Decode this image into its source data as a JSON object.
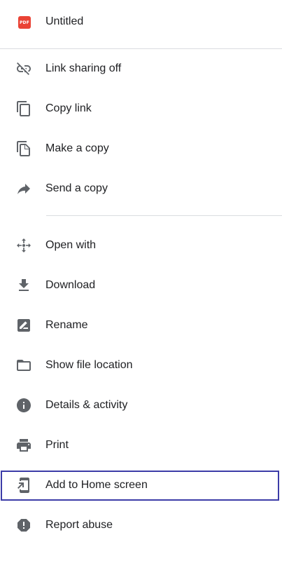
{
  "file": {
    "title": "Untitled",
    "type_badge": "PDF"
  },
  "colors": {
    "icon": "#5f6368",
    "pdf_badge": "#ea4335",
    "highlight_border": "#3c3ca8",
    "divider": "#dadce0"
  },
  "menu": {
    "items": [
      {
        "label": "Link sharing off",
        "icon": "link-off-icon"
      },
      {
        "label": "Copy link",
        "icon": "copy-icon"
      },
      {
        "label": "Make a copy",
        "icon": "make-copy-icon"
      },
      {
        "label": "Send a copy",
        "icon": "share-arrow-icon"
      },
      {
        "label": "Open with",
        "icon": "open-with-icon"
      },
      {
        "label": "Download",
        "icon": "download-icon"
      },
      {
        "label": "Rename",
        "icon": "rename-icon"
      },
      {
        "label": "Show file location",
        "icon": "folder-icon"
      },
      {
        "label": "Details & activity",
        "icon": "info-icon"
      },
      {
        "label": "Print",
        "icon": "print-icon"
      },
      {
        "label": "Add to Home screen",
        "icon": "add-to-home-icon",
        "highlighted": true
      },
      {
        "label": "Report abuse",
        "icon": "report-icon"
      }
    ]
  }
}
